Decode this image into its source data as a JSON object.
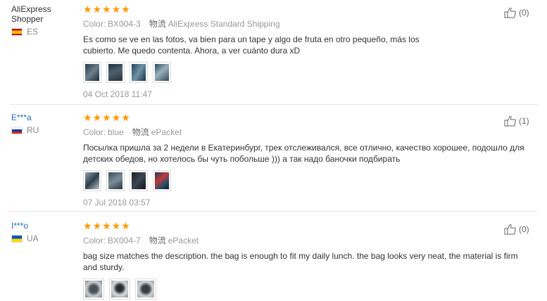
{
  "reviews": [
    {
      "user": "AliExpress Shopper",
      "country": "ES",
      "flag": "flag-es",
      "rating": 5,
      "color_label": "Color:",
      "color_value": "BX004-3",
      "ship_label": "物流",
      "ship_value": "AliExpress Standard Shipping",
      "text": "Es como se ve en las fotos, va bien para un tape y algo de fruta en otro pequeño, más los cubierto. Me quedo contenta. Ahora, a ver cuánto dura xD",
      "photo_count": 4,
      "date": "04 Oct 2018 11:47",
      "helpful": "(0)"
    },
    {
      "user": "E***a",
      "country": "RU",
      "flag": "flag-ru",
      "rating": 5,
      "color_label": "Color:",
      "color_value": "blue",
      "ship_label": "物流",
      "ship_value": "ePacket",
      "text": "Посылка пришла за 2 недели в Екатеринбург, трек отслеживался, все отлично, качество хорошее, подошло для детских обедов, но хотелось бы чуть побольше ))) а так надо баночки подбирать",
      "photo_count": 4,
      "date": "07 Jul 2018 03:57",
      "helpful": "(1)"
    },
    {
      "user": "I***o",
      "country": "UA",
      "flag": "flag-ua",
      "rating": 5,
      "color_label": "Color:",
      "color_value": "BX004-7",
      "ship_label": "物流",
      "ship_value": "ePacket",
      "text": "bag size matches the description. the bag is enough to fit my daily lunch. the bag looks very neat, the material is firm and sturdy.",
      "photo_count": 3,
      "date": "",
      "helpful": "(0)"
    }
  ],
  "colors": {
    "star": "#ff9900",
    "link": "#2a6bbf"
  },
  "icons": {
    "like": "thumbs-up-icon",
    "rating": "star-icon"
  }
}
